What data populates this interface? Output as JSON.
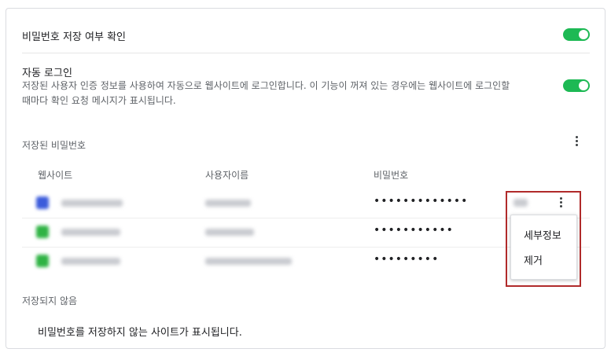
{
  "settings": {
    "save_passwords_label": "비밀번호 저장 여부 확인",
    "save_passwords_on": true,
    "auto_login_label": "자동 로그인",
    "auto_login_desc_line1": "저장된 사용자 인증 정보를 사용하여 자동으로 웹사이트에 로그인합니다. 이 기능이 꺼져 있는 경우에는 웹사이트에 로그인할",
    "auto_login_desc_line2": "때마다 확인 요청 메시지가 표시됩니다.",
    "auto_login_on": true,
    "toggle_color": "#1db954"
  },
  "saved_passwords": {
    "title": "저장된 비밀번호",
    "columns": [
      "웹사이트",
      "사용자이름",
      "비밀번호"
    ],
    "rows": [
      {
        "site": "facebook.com",
        "username": "••••••••",
        "password": "•••••••••••••",
        "favicon_color": "#3b5bdb"
      },
      {
        "site": "nid.naver.com",
        "username": "••••••••",
        "password": "•••••••••••",
        "favicon_color": "#2fb344"
      },
      {
        "site": "nid.naver.com",
        "username": "••••••••",
        "password": "•••••••••",
        "favicon_color": "#2fb344"
      }
    ]
  },
  "context_menu": {
    "items": [
      "세부정보",
      "제거"
    ]
  },
  "not_saved": {
    "title": "저장되지 않음",
    "empty_text": "비밀번호를 저장하지 않는 사이트가 표시됩니다."
  }
}
